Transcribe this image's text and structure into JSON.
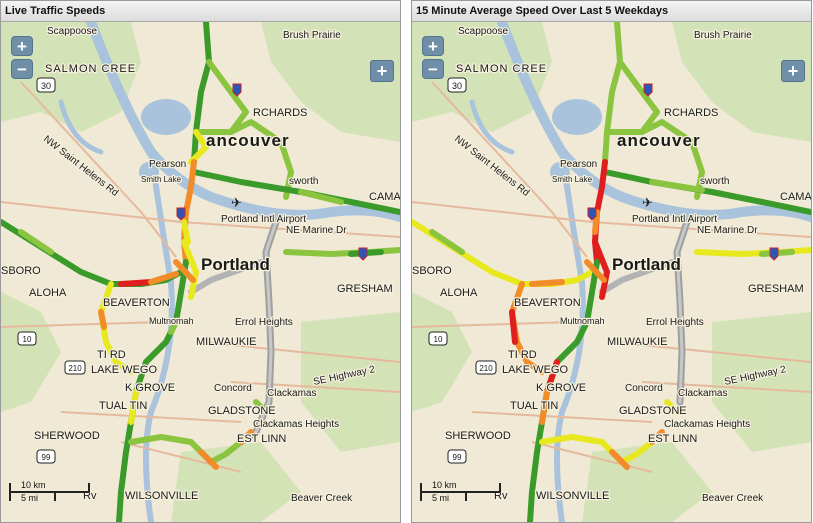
{
  "panels": [
    {
      "title": "Live Traffic Speeds",
      "zoom_in": "+",
      "zoom_out": "−",
      "layers": "+",
      "scale_km": "10 km",
      "scale_mi": "5 mi"
    },
    {
      "title": "15 Minute Average Speed Over Last 5 Weekdays",
      "zoom_in": "+",
      "zoom_out": "−",
      "layers": "+",
      "scale_km": "10 km",
      "scale_mi": "5 mi"
    }
  ],
  "places": {
    "scappoose": "Scappoose",
    "brush_prairie": "Brush Prairie",
    "salmon_creek": "SALMON CREE",
    "orchards": "RCHARDS",
    "vancouver": "ancouver",
    "pearson": "Pearson",
    "smith_lake": "Smith Lake",
    "ellsworth": "sworth",
    "camas": "CAMA",
    "portland_airport": "Portland Intl Airport",
    "ne_marine": "NE Marine Dr",
    "portland": "Portland",
    "hillsboro": "SBORO",
    "aloha": "ALOHA",
    "beaverton": "BEAVERTON",
    "multnomah": "Multnomah",
    "errol_heights": "Errol Heights",
    "gresham": "GRESHAM",
    "milwaukie": "MILWAUKIE",
    "tigard": "TI  RD",
    "lake_oswego": "LAKE  WEGO",
    "oak_grove": "  K GROVE",
    "concord": "Concord",
    "clackamas": "Clackamas",
    "se_highway": "SE Highway 2",
    "tualatin": "TUAL  TIN",
    "gladstone": "GLADSTONE",
    "clackamas_heights": "Clackamas Heights",
    "sherwood": "SHERWOOD",
    "west_linn": "EST LINN",
    "wilsonville": "WILSONVILLE",
    "beaver_creek": "Beaver Creek",
    "nw_st_helens": "NW Saint Helens Rd",
    "rte_30": "30",
    "rte_10": "10",
    "rte_210": "210",
    "rte_99": "99",
    "ca_fre": "Ca",
    "rv_label": "Rv",
    "ville_label": "ville"
  },
  "speed_colors": {
    "fast": "#3a9a2a",
    "good": "#8bc53f",
    "moderate": "#e8e81e",
    "slow": "#f28c28",
    "stopped": "#e01e1e",
    "no_data": "#b3b3b3"
  },
  "theme": {
    "land": "#efe9d6",
    "water": "#a9c3dc",
    "park": "#cfe2b1",
    "road_minor": "#e6b99d"
  }
}
